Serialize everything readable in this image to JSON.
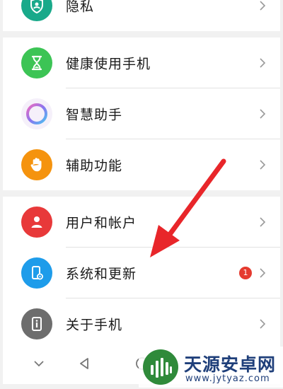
{
  "settings": {
    "group1": {
      "items": [
        {
          "label": "隐私",
          "icon": "privacy-shield-icon",
          "color": "#19a98a"
        }
      ]
    },
    "group2": {
      "items": [
        {
          "label": "健康使用手机",
          "icon": "hourglass-icon",
          "color": "#3cc455"
        },
        {
          "label": "智慧助手",
          "icon": "assistant-ring-icon",
          "color": "#8a74f0"
        },
        {
          "label": "辅助功能",
          "icon": "hand-icon",
          "color": "#f5930e"
        }
      ]
    },
    "group3": {
      "items": [
        {
          "label": "用户和帐户",
          "icon": "user-icon",
          "color": "#e8393a"
        },
        {
          "label": "系统和更新",
          "icon": "phone-settings-icon",
          "color": "#1e9cea",
          "badge": "1"
        },
        {
          "label": "关于手机",
          "icon": "info-phone-icon",
          "color": "#6d6d6d"
        }
      ]
    }
  },
  "watermark": {
    "name": "天源安卓网",
    "url": "www.jytyaz.com"
  },
  "colors": {
    "badge": "#e53a2f",
    "arrow": "#e8262a",
    "background": "#f1f1f1"
  }
}
